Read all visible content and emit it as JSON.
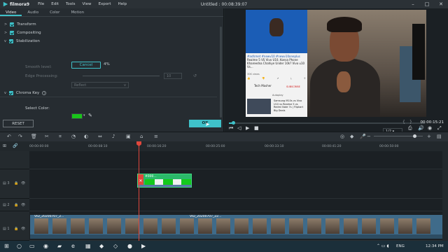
{
  "app": {
    "name": "filmora9",
    "menu": [
      "File",
      "Edit",
      "Tools",
      "View",
      "Export",
      "Help"
    ],
    "window_title": "Untitled :  00:08:39:07"
  },
  "editor": {
    "tabs": [
      "Video",
      "Audio",
      "Color",
      "Motion"
    ],
    "sections": {
      "transform": "Transform",
      "compositing": "Compositing",
      "stabilization": "Stabilization",
      "chroma_key": "Chroma Key"
    },
    "stabilization": {
      "cancel_label": "Cancel",
      "progress": "4%",
      "smooth_level_label": "Smooth level:",
      "smooth_level_value": "10",
      "edge_processing_label": "Edge Processing:",
      "edge_processing_value": "Reflect"
    },
    "chroma_key": {
      "select_color_label": "Select Color:",
      "color": "#19c51a"
    },
    "reset_label": "RESET",
    "ok_label": "OK"
  },
  "preview": {
    "overlay_text": {
      "hashtags": "#asfsmet #newv10 #newv10oneplus",
      "title": "Realme 5 VS Vivo U10, Konsa Phone Khareedna Chahiye Under 10k? Vivo u10 Vs...",
      "views": "30K views",
      "channel": "Tech Masher",
      "subscribe": "SUBSCRIBE",
      "autoplay": "Autoplay",
      "related": "Samsung M10s vs Vivo U10 vs Realme 5 vs Redmi Note 7s | Flipkart Big Deals"
    },
    "timecode": "00:00:15:21",
    "ratio": "1/2",
    "progress_fraction": 0.02
  },
  "timeline": {
    "ruler": [
      "00:00:00:00",
      "00:00:08:10",
      "00:00:16:20",
      "00:00:25:00",
      "00:00:33:10",
      "00:00:41:20",
      "00:00:50:00"
    ],
    "pip_clip_label": "#000...",
    "main_clip_label": "VID_20200707_2...",
    "main_clip_label2": "VID_20200707_22..."
  },
  "taskbar": {
    "lang": "ENG",
    "time": "12:34 PM"
  },
  "colors": {
    "accent": "#3fc1c9",
    "playhead": "#e0473c",
    "chroma": "#19c51a"
  }
}
